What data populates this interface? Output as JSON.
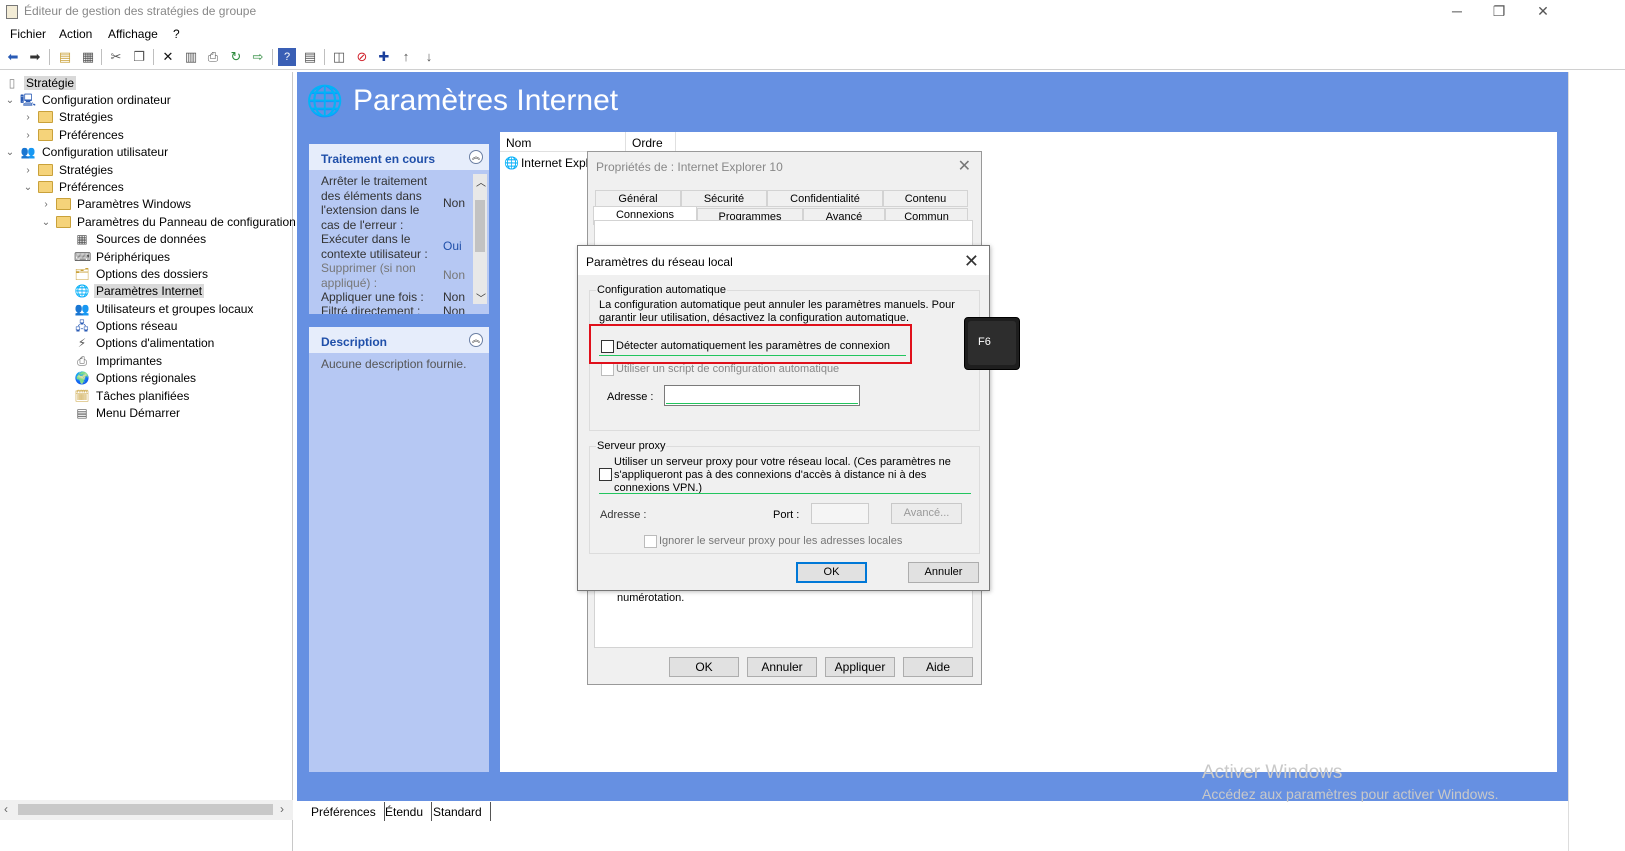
{
  "window": {
    "title": "Éditeur de gestion des stratégies de groupe",
    "minimize_glyph": "─",
    "restore_glyph": "❐",
    "close_glyph": "✕"
  },
  "menu": [
    "Fichier",
    "Action",
    "Affichage",
    "?"
  ],
  "toolbar_icons": [
    "back-arrow-icon",
    "forward-arrow-icon",
    "up-folder-icon",
    "show-hide-tree-icon",
    "cut-icon",
    "copy-icon",
    "delete-icon",
    "properties-icon",
    "print-icon",
    "refresh-icon",
    "export-icon",
    "help-icon",
    "details-view-icon",
    "preview-icon",
    "block-icon",
    "add-icon",
    "move-up-icon",
    "move-down-icon"
  ],
  "tree": {
    "root": "Stratégie",
    "computer_config": "Configuration ordinateur",
    "cc_strategies": "Stratégies",
    "cc_preferences": "Préférences",
    "user_config": "Configuration utilisateur",
    "uc_strategies": "Stratégies",
    "uc_preferences": "Préférences",
    "windows_settings": "Paramètres Windows",
    "control_panel_settings": "Paramètres du Panneau de configuration",
    "items": [
      "Sources de données",
      "Périphériques",
      "Options des dossiers",
      "Paramètres Internet",
      "Utilisateurs et groupes locaux",
      "Options réseau",
      "Options d'alimentation",
      "Imprimantes",
      "Options régionales",
      "Tâches planifiées",
      "Menu Démarrer"
    ]
  },
  "main": {
    "header": "Paramètres Internet",
    "processing_panel": {
      "title": "Traitement en cours",
      "rows": [
        {
          "label": "Arrêter le traitement des éléments dans l'extension dans le cas de l'erreur :",
          "value": "Non"
        },
        {
          "label": "Exécuter dans le contexte utilisateur :",
          "value": "Oui"
        },
        {
          "label": "Supprimer (si non appliqué) :",
          "value": "Non"
        },
        {
          "label": "Appliquer une fois :",
          "value": "Non"
        },
        {
          "label": "Filtré directement :",
          "value": "Non"
        }
      ]
    },
    "description_panel": {
      "title": "Description",
      "text": "Aucune description fournie."
    },
    "list_columns": [
      "Nom",
      "Ordre"
    ],
    "list_item": "Internet Explo",
    "bottom_tabs": [
      "Préférences",
      "Étendu",
      "Standard"
    ],
    "watermark_title": "Activer Windows",
    "watermark_sub": "Accédez aux paramètres pour activer Windows."
  },
  "properties_dialog": {
    "title": "Propriétés de : Internet Explorer 10",
    "tabs_row1": [
      "Général",
      "Sécurité",
      "Confidentialité",
      "Contenu"
    ],
    "tabs_row2": [
      "Connexions",
      "Programmes",
      "Avancé",
      "Commun"
    ],
    "body_fragment": "numérotation.",
    "buttons": [
      "OK",
      "Annuler",
      "Appliquer",
      "Aide"
    ]
  },
  "lan_dialog": {
    "title": "Paramètres du réseau local",
    "auto_group": "Configuration automatique",
    "auto_desc": "La configuration automatique peut annuler les paramètres manuels. Pour garantir leur utilisation, désactivez la configuration automatique.",
    "auto_detect": "Détecter automatiquement les paramètres de connexion",
    "use_script": "Utiliser un script de configuration automatique",
    "address_label": "Adresse :",
    "proxy_group": "Serveur proxy",
    "proxy_desc": "Utiliser un serveur proxy pour votre réseau local. (Ces paramètres ne s'appliqueront pas à des connexions d'accès à distance ni à des connexions VPN.)",
    "proxy_address_label": "Adresse :",
    "port_label": "Port :",
    "advanced_button": "Avancé...",
    "bypass_local": "Ignorer le serveur proxy pour les adresses locales",
    "ok_button": "OK",
    "cancel_button": "Annuler"
  },
  "key_overlay": "F6",
  "colors": {
    "header_blue": "#6690e2",
    "panel_blue": "#b6c8f3",
    "highlight_red": "#e0101b",
    "underline_green": "#22c55e"
  }
}
